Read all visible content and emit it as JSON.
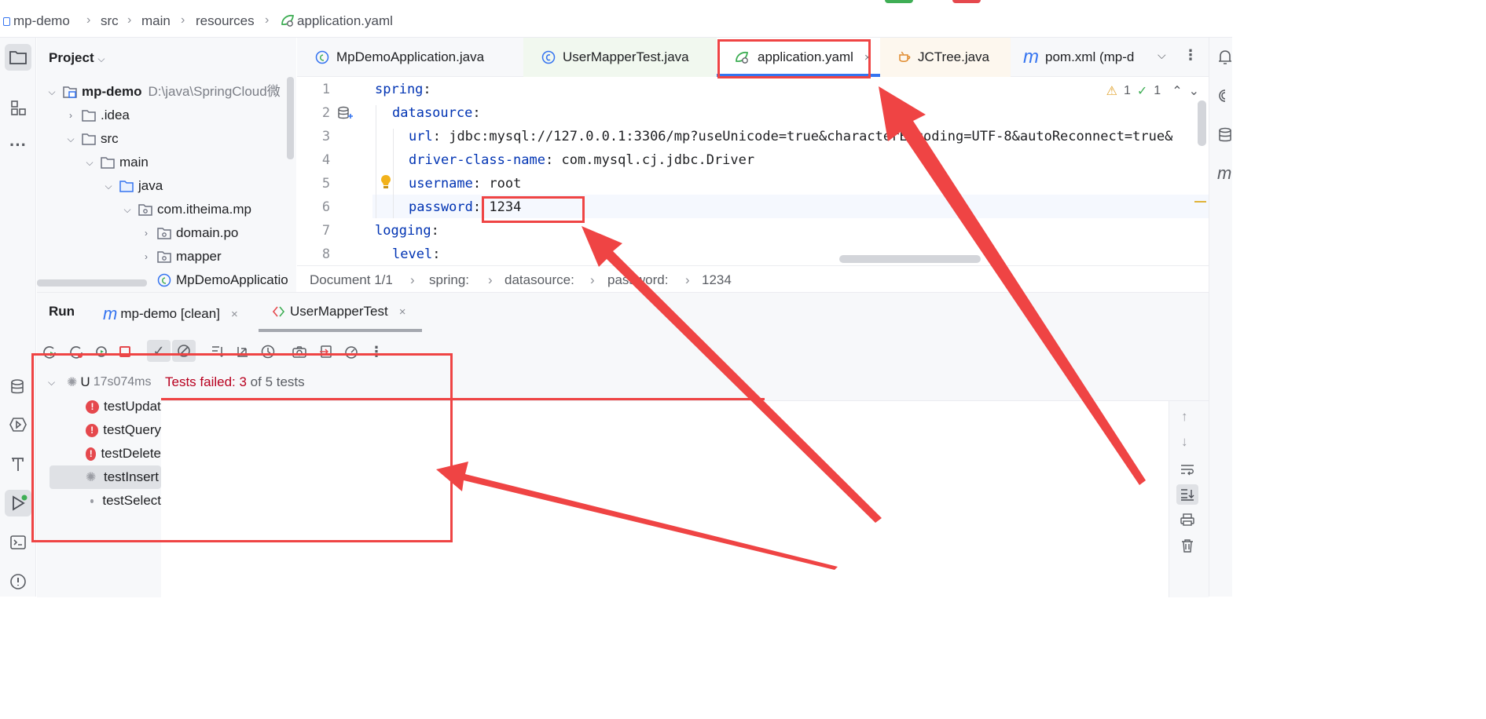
{
  "breadcrumb": [
    "mp-demo",
    "src",
    "main",
    "resources",
    "application.yaml"
  ],
  "project": {
    "title": "Project",
    "tree": [
      {
        "label": "mp-demo",
        "path": "D:\\java\\SpringCloud微",
        "type": "module",
        "expanded": true
      },
      {
        "label": ".idea",
        "type": "folder",
        "expanded": false
      },
      {
        "label": "src",
        "type": "folder",
        "expanded": true
      },
      {
        "label": "main",
        "type": "folder",
        "expanded": true
      },
      {
        "label": "java",
        "type": "source-folder",
        "expanded": true
      },
      {
        "label": "com.itheima.mp",
        "type": "package",
        "expanded": true
      },
      {
        "label": "domain.po",
        "type": "package",
        "expanded": false
      },
      {
        "label": "mapper",
        "type": "package",
        "expanded": false
      },
      {
        "label": "MpDemoApplicatio",
        "type": "spring-class"
      }
    ]
  },
  "editor": {
    "tabs": [
      {
        "label": "MpDemoApplication.java",
        "icon": "spring-class-icon",
        "selected": false
      },
      {
        "label": "UserMapperTest.java",
        "icon": "test-class-icon",
        "selected": false
      },
      {
        "label": "application.yaml",
        "icon": "spring-yaml-icon",
        "selected": true,
        "close": "×"
      },
      {
        "label": "JCTree.java",
        "icon": "java-file-icon",
        "selected": false
      },
      {
        "label": "pom.xml (mp-d",
        "icon": "maven-icon",
        "selected": false
      }
    ],
    "inspections": {
      "warnings": "1",
      "ok": "1"
    },
    "lines": [
      {
        "n": "1",
        "key": "spring",
        "value": ""
      },
      {
        "n": "2",
        "key": "datasource",
        "value": ""
      },
      {
        "n": "3",
        "key": "url",
        "value": "jdbc:mysql://127.0.0.1:3306/mp?useUnicode=true&characterEncoding=UTF-8&autoReconnect=true&"
      },
      {
        "n": "4",
        "key": "driver-class-name",
        "value": "com.mysql.cj.jdbc.Driver"
      },
      {
        "n": "5",
        "key": "username",
        "value": "root"
      },
      {
        "n": "6",
        "key": "password",
        "value": "1234"
      },
      {
        "n": "7",
        "key": "logging",
        "value": ""
      },
      {
        "n": "8",
        "key": "level",
        "value": ""
      }
    ],
    "doc_crumbs": [
      "Document 1/1",
      "spring:",
      "datasource:",
      "password:",
      "1234"
    ]
  },
  "run": {
    "title": "Run",
    "tabs": [
      {
        "label": "mp-demo [clean]",
        "icon": "maven-icon"
      },
      {
        "label": "UserMapperTest",
        "icon": "test-class-icon"
      }
    ],
    "root": {
      "label": "U",
      "time": "17s074ms"
    },
    "status": {
      "failed_label": "Tests failed: 3",
      "rest": " of 5 tests"
    },
    "tests": [
      {
        "label": "testUpdat",
        "status": "failed"
      },
      {
        "label": "testQuery",
        "status": "failed"
      },
      {
        "label": "testDelete",
        "status": "failed"
      },
      {
        "label": "testInsert",
        "status": "running"
      },
      {
        "label": "testSelect",
        "status": "pending"
      }
    ]
  },
  "colors": {
    "accent": "#3574f0",
    "annotation": "#ef4444",
    "error": "#e5484d",
    "failed_text": "#b8001f",
    "yaml_key": "#0033b3"
  }
}
